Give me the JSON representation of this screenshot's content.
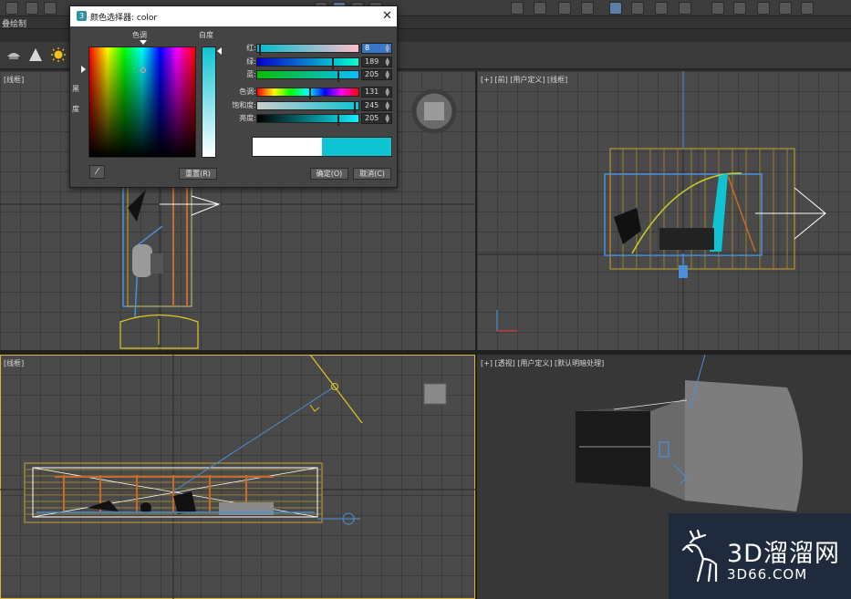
{
  "app": {
    "toolbar_label": "叠绘制"
  },
  "viewports": {
    "top_left": {
      "label": "[线框]"
    },
    "top_right": {
      "label": "[+] [前] [用户定义] [线框]"
    },
    "bottom_left": {
      "label": "[线框]"
    },
    "bottom_right": {
      "label": "[+] [透视] [用户定义] [默认明暗处理]"
    }
  },
  "color_dialog": {
    "icon_text": "3",
    "title": "颜色选择器: color",
    "close_label": "✕",
    "hue_label": "色调",
    "whiteness_label": "白度",
    "blackness_label": "黑度",
    "reset_label": "重置(R)",
    "ok_label": "确定(O)",
    "cancel_label": "取消(C)",
    "eyedropper_icon": "eyedropper-icon",
    "fields": {
      "red": {
        "label": "红:",
        "value": "8"
      },
      "green": {
        "label": "绿:",
        "value": "189"
      },
      "blue": {
        "label": "蓝:",
        "value": "205"
      },
      "hue": {
        "label": "色调:",
        "value": "131"
      },
      "saturation": {
        "label": "饱和度:",
        "value": "245"
      },
      "value": {
        "label": "亮度:",
        "value": "205"
      }
    },
    "old_color": "#ffffff",
    "new_color": "#0fc3d2"
  },
  "watermark": {
    "title": "3D溜溜网",
    "url": "3D66.COM"
  },
  "colors": {
    "grid_bg": "#4a4a4a",
    "active_border": "#d9b43a",
    "object_yellow": "#c9a22a",
    "object_blue": "#4a90d9",
    "object_orange": "#c96a2a",
    "selected_cyan": "#0fc3d2"
  }
}
